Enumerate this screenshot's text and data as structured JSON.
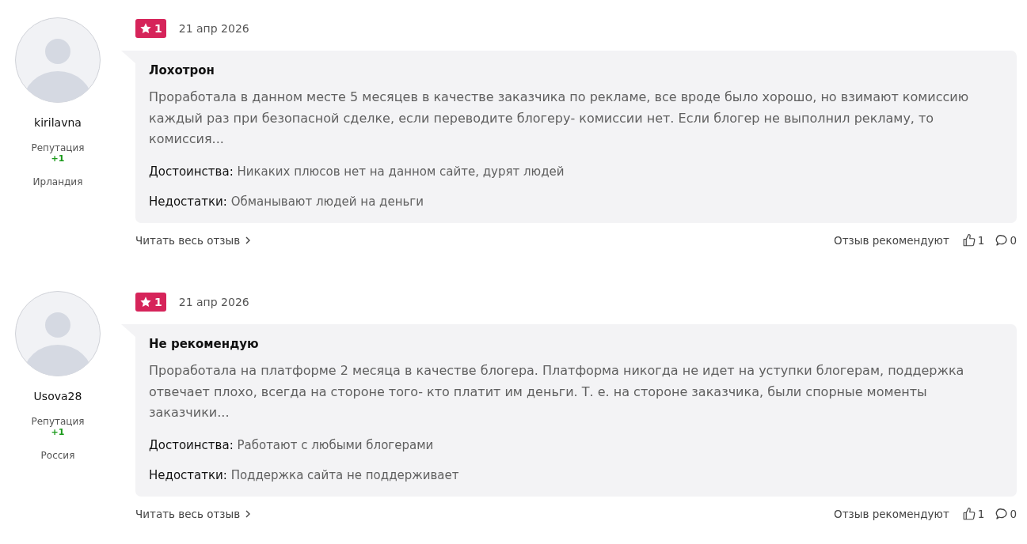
{
  "reviews": [
    {
      "author": {
        "name": "kirilavna",
        "reputation_label": "Репутация",
        "reputation": "+1",
        "country": "Ирландия"
      },
      "rating": "1",
      "date": "21 апр 2026",
      "title": "Лохотрон",
      "text": "Проработала в данном месте 5 месяцев в качестве заказчика по рекламе, все вроде было хорошо, но взимают комиссию каждый раз при безопасной сделке, если переводите блогеру- комиссии нет. Если блогер не выполнил рекламу, то комиссия...",
      "pros_label": "Достоинства:",
      "pros": "Никаких плюсов нет на данном сайте, дурят людей",
      "cons_label": "Недостатки:",
      "cons": "Обманывают людей на деньги",
      "read_more": "Читать весь отзыв",
      "recommend_label": "Отзыв рекомендуют",
      "likes": "1",
      "comments": "0"
    },
    {
      "author": {
        "name": "Usova28",
        "reputation_label": "Репутация",
        "reputation": "+1",
        "country": "Россия"
      },
      "rating": "1",
      "date": "21 апр 2026",
      "title": "Не рекомендую",
      "text": "Проработала на платформе 2 месяца в качестве блогера. Платформа никогда не идет на уступки блогерам, поддержка отвечает плохо, всегда на стороне того- кто платит им деньги. Т. е. на стороне заказчика, были спорные моменты заказчики...",
      "pros_label": "Достоинства:",
      "pros": "Работают с любыми блогерами",
      "cons_label": "Недостатки:",
      "cons": "Поддержка сайта не поддерживает",
      "read_more": "Читать весь отзыв",
      "recommend_label": "Отзыв рекомендуют",
      "likes": "1",
      "comments": "0"
    }
  ]
}
